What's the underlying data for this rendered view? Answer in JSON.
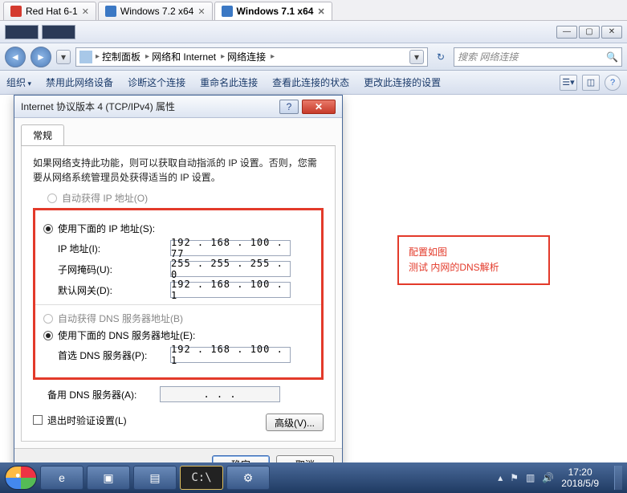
{
  "vm_tabs": {
    "t0": {
      "label": "Red Hat 6-1"
    },
    "t1": {
      "label": "Windows 7.2 x64"
    },
    "t2": {
      "label": "Windows 7.1 x64"
    }
  },
  "breadcrumb": {
    "root": "控制面板",
    "p1": "网络和 Internet",
    "p2": "网络连接"
  },
  "search": {
    "placeholder": "搜索 网络连接"
  },
  "cmdbar": {
    "organize": "组织",
    "disable": "禁用此网络设备",
    "diagnose": "诊断这个连接",
    "rename": "重命名此连接",
    "status": "查看此连接的状态",
    "change": "更改此连接的设置"
  },
  "dialog": {
    "title": "Internet 协议版本 4 (TCP/IPv4) 属性",
    "tab_general": "常规",
    "desc": "如果网络支持此功能，则可以获取自动指派的 IP 设置。否则，您需要从网络系统管理员处获得适当的 IP 设置。",
    "auto_ip": "自动获得 IP 地址(O)",
    "use_ip": "使用下面的 IP 地址(S):",
    "ip_label": "IP 地址(I):",
    "ip_val": "192 . 168 . 100 .  77",
    "mask_label": "子网掩码(U):",
    "mask_val": "255 . 255 . 255 .   0",
    "gw_label": "默认网关(D):",
    "gw_val": "192 . 168 . 100 .   1",
    "auto_dns": "自动获得 DNS 服务器地址(B)",
    "use_dns": "使用下面的 DNS 服务器地址(E):",
    "dns1_label": "首选 DNS 服务器(P):",
    "dns1_val": "192 . 168 . 100 .   1",
    "dns2_label": "备用 DNS 服务器(A):",
    "dns2_val": "   .    .    .   ",
    "validate": "退出时验证设置(L)",
    "advanced": "高级(V)...",
    "ok": "确定",
    "cancel": "取消"
  },
  "annotation": {
    "line1": "配置如图",
    "line2": "测试 内网的DNS解析"
  },
  "clock": {
    "time": "17:20",
    "date": "2018/5/9"
  }
}
